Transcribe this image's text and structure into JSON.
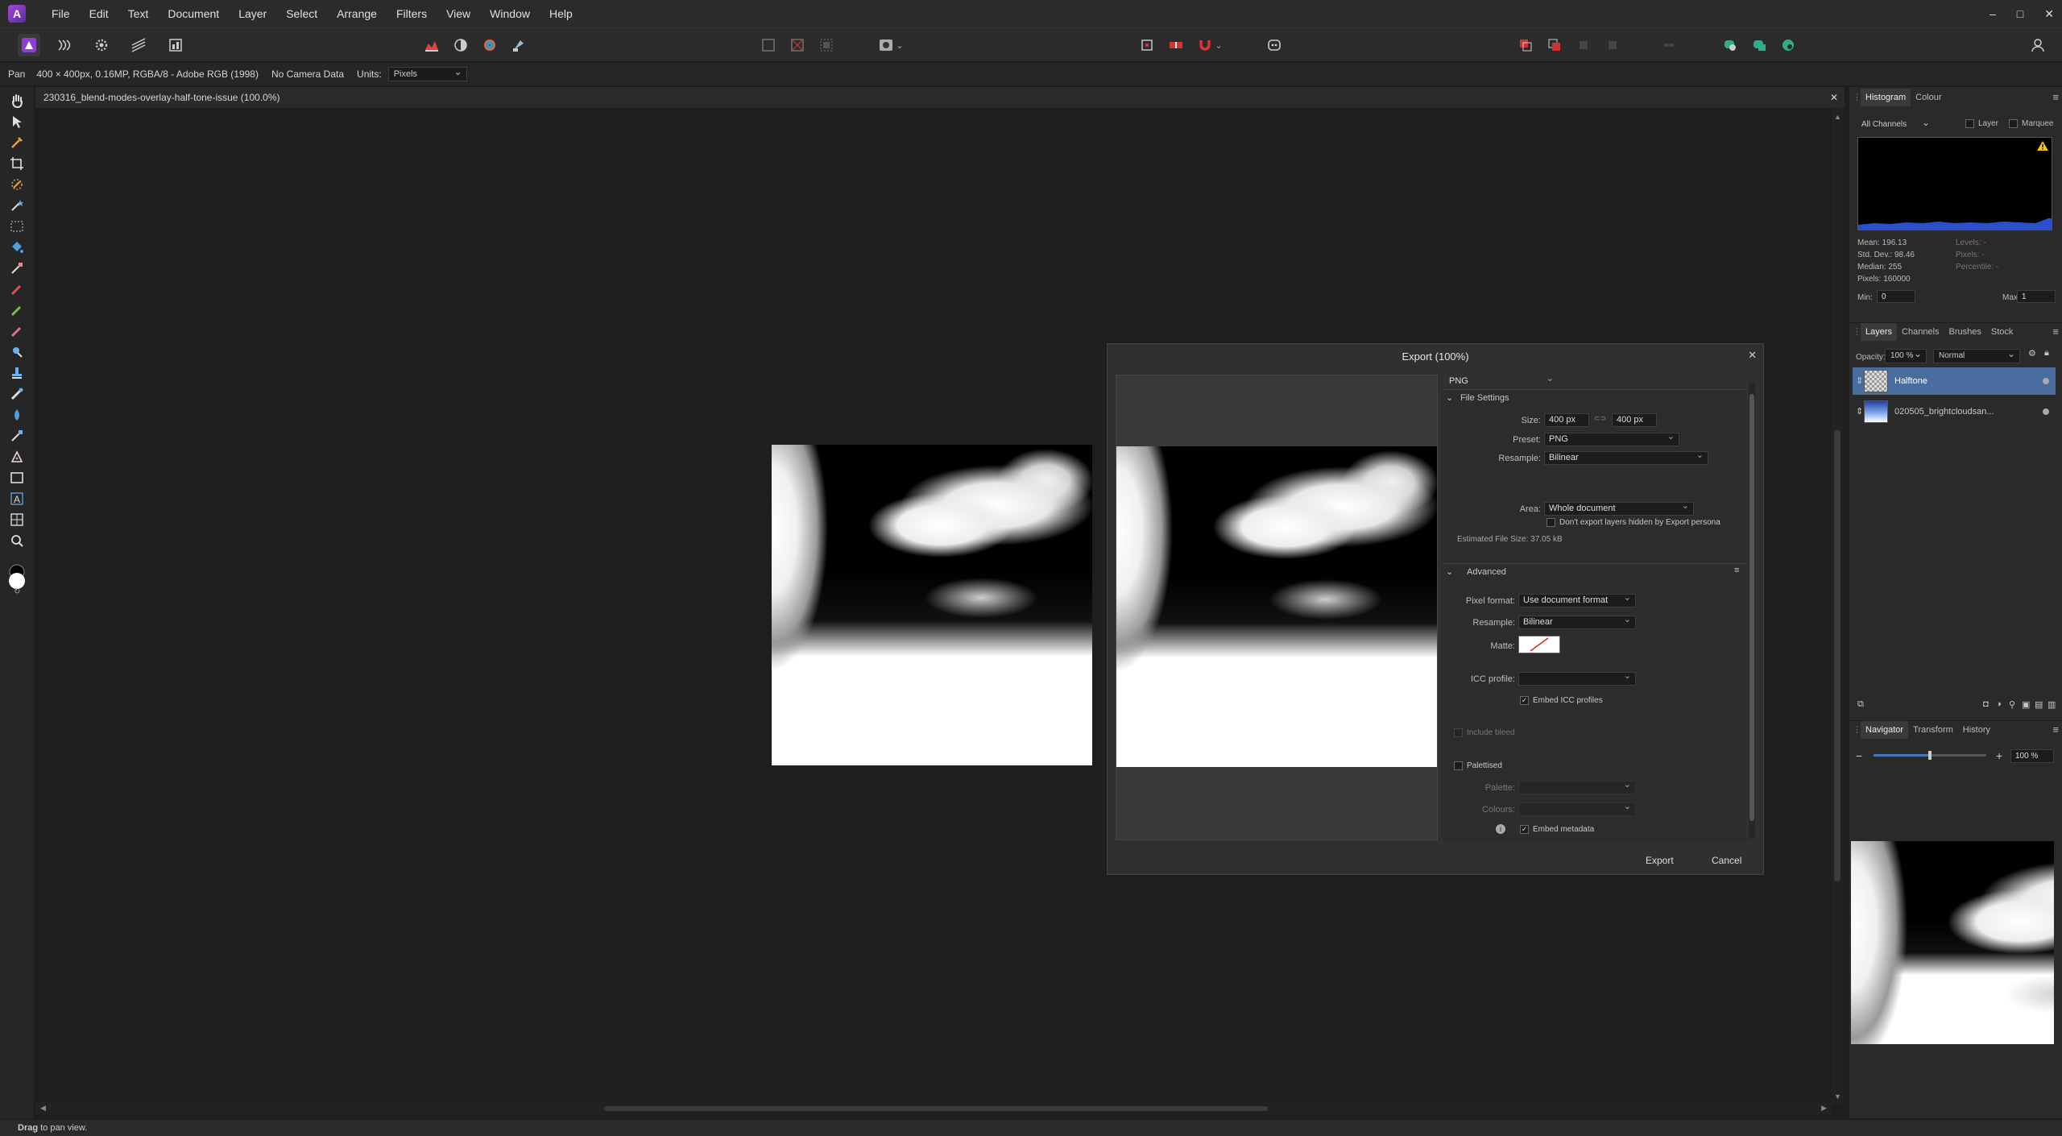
{
  "menu": {
    "items": [
      "File",
      "Edit",
      "Text",
      "Document",
      "Layer",
      "Select",
      "Arrange",
      "Filters",
      "View",
      "Window",
      "Help"
    ],
    "logo_letter": "A"
  },
  "window_controls": {
    "minimize": "–",
    "maximize": "□",
    "close": "✕"
  },
  "context_bar": {
    "tool": "Pan",
    "doc_info": "400 × 400px, 0.16MP, RGBA/8 - Adobe RGB (1998)",
    "camera": "No Camera Data",
    "units_label": "Units:",
    "units_value": "Pixels"
  },
  "document": {
    "tab_title": "230316_blend-modes-overlay-half-tone-issue (100.0%)",
    "close": "✕"
  },
  "export_dialog": {
    "title": "Export (100%)",
    "format": "PNG",
    "file_settings": {
      "heading": "File Settings",
      "size_label": "Size:",
      "width": "400 px",
      "height": "400 px",
      "preset_label": "Preset:",
      "preset": "PNG",
      "resample_label": "Resample:",
      "resample": "Bilinear",
      "area_label": "Area:",
      "area": "Whole document",
      "hidden_layers": "Don't export layers hidden by Export persona",
      "estimated": "Estimated File Size: 37.05 kB"
    },
    "advanced": {
      "heading": "Advanced",
      "pixel_format_label": "Pixel format:",
      "pixel_format": "Use document format",
      "resample_label": "Resample:",
      "resample": "Bilinear",
      "matte_label": "Matte:",
      "icc_label": "ICC profile:",
      "icc": "",
      "embed_icc": "Embed ICC profiles",
      "include_bleed": "Include bleed",
      "palettised": "Palettised",
      "palette_label": "Palette:",
      "colours_label": "Colours:",
      "embed_metadata": "Embed metadata"
    },
    "export_button": "Export",
    "cancel_button": "Cancel"
  },
  "histogram_panel": {
    "tabs": [
      "Histogram",
      "Colour"
    ],
    "channels": "All Channels",
    "layer_label": "Layer",
    "marquee_label": "Marquee",
    "mean": "Mean: 196.13",
    "std_dev": "Std. Dev.: 98.46",
    "median": "Median: 255",
    "pixels": "Pixels: 160000",
    "levels": "Levels: -",
    "pixels_right": "Pixels: -",
    "percentile": "Percentile: -",
    "min_label": "Min:",
    "min_value": "0",
    "max_label": "Max:",
    "max_value": "1"
  },
  "layers_panel": {
    "tabs": [
      "Layers",
      "Channels",
      "Brushes",
      "Stock"
    ],
    "opacity_label": "Opacity:",
    "opacity": "100 %",
    "blend_mode": "Normal",
    "layers": [
      {
        "name": "Halftone",
        "selected": true
      },
      {
        "name": "020505_brightcloudsan...",
        "selected": false
      }
    ]
  },
  "navigator_panel": {
    "tabs": [
      "Navigator",
      "Transform",
      "History"
    ],
    "zoom": "100 %",
    "zoom_level": 0.5
  },
  "status_bar": {
    "bold": "Drag",
    "text": "to pan view."
  },
  "colors": {
    "accent": "#4a76b8",
    "selected_layer": "#4a6da0",
    "warning": "#f5c518"
  }
}
